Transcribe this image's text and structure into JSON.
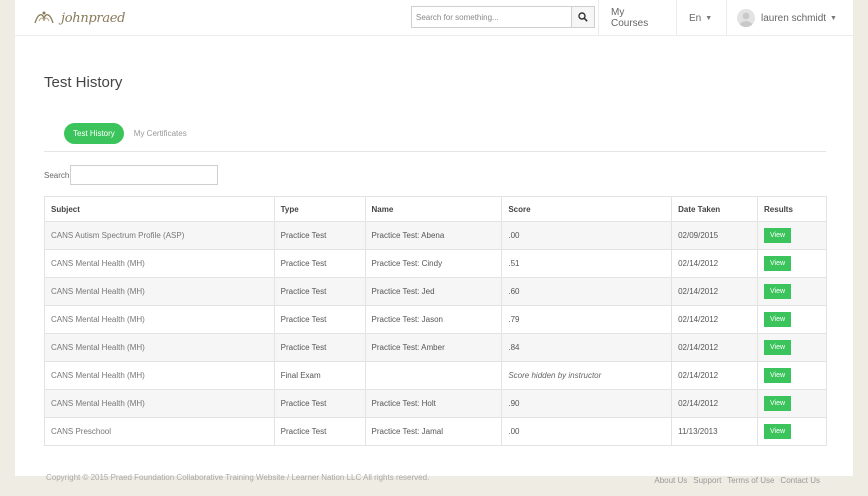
{
  "header": {
    "logo_text": "johnpraed",
    "search_placeholder": "Search for something...",
    "nav": {
      "courses": "My Courses",
      "language": "En",
      "user": "lauren schmidt"
    }
  },
  "main": {
    "title": "Test History",
    "tabs": [
      {
        "label": "Test History",
        "active": true
      },
      {
        "label": "My Certificates",
        "active": false
      }
    ],
    "search_label": "Search",
    "table": {
      "columns": [
        "Subject",
        "Type",
        "Name",
        "Score",
        "Date Taken",
        "Results"
      ],
      "rows": [
        {
          "subject": "CANS Autism Spectrum Profile (ASP)",
          "type": "Practice Test",
          "name": "Practice Test: Abena",
          "score": ".00",
          "date": "02/09/2015",
          "result": "View"
        },
        {
          "subject": "CANS Mental Health (MH)",
          "type": "Practice Test",
          "name": "Practice Test: Cindy",
          "score": ".51",
          "date": "02/14/2012",
          "result": "View"
        },
        {
          "subject": "CANS Mental Health (MH)",
          "type": "Practice Test",
          "name": "Practice Test: Jed",
          "score": ".60",
          "date": "02/14/2012",
          "result": "View"
        },
        {
          "subject": "CANS Mental Health (MH)",
          "type": "Practice Test",
          "name": "Practice Test: Jason",
          "score": ".79",
          "date": "02/14/2012",
          "result": "View"
        },
        {
          "subject": "CANS Mental Health (MH)",
          "type": "Practice Test",
          "name": "Practice Test: Amber",
          "score": ".84",
          "date": "02/14/2012",
          "result": "View"
        },
        {
          "subject": "CANS Mental Health (MH)",
          "type": "Final Exam",
          "name": "",
          "score": "Score hidden by instructor",
          "date": "02/14/2012",
          "result": "View"
        },
        {
          "subject": "CANS Mental Health (MH)",
          "type": "Practice Test",
          "name": "Practice Test: Holt",
          "score": ".90",
          "date": "02/14/2012",
          "result": "View"
        },
        {
          "subject": "CANS Preschool",
          "type": "Practice Test",
          "name": "Practice Test: Jamal",
          "score": ".00",
          "date": "11/13/2013",
          "result": "View"
        }
      ]
    }
  },
  "footer": {
    "copyright": "Copyright © 2015 Praed Foundation Collaborative Training Website / Learner Nation LLC All rights reserved.",
    "links": [
      "About Us",
      "Support",
      "Terms of Use",
      "Contact Us"
    ]
  },
  "colors": {
    "accent": "#3cc45c",
    "background": "#efece3"
  },
  "icons": {
    "search": "search-icon",
    "user": "user-avatar-icon",
    "caret": "caret-down-icon"
  }
}
